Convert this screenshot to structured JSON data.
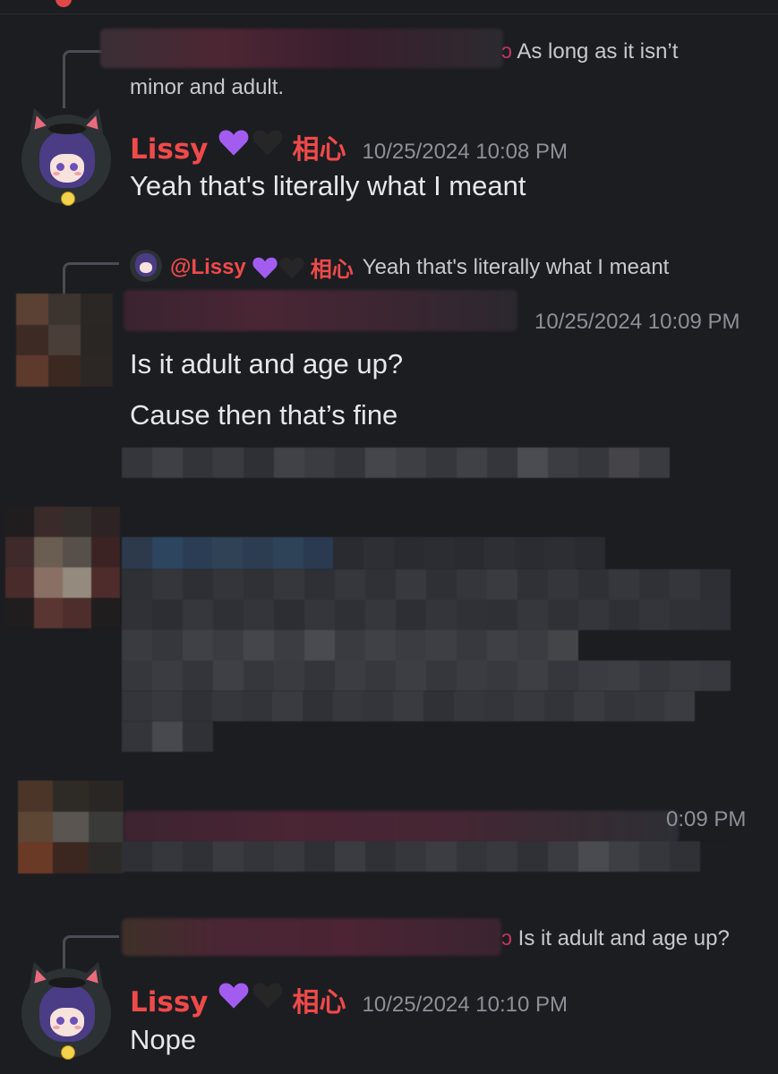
{
  "messages": [
    {
      "reply_text_line1": "As long as it isn’t",
      "reply_text_line2": "minor and adult.",
      "username": "Lissy",
      "emoji_1": "purple-heart-icon",
      "emoji_2": "black-heart-icon",
      "tag": "相心",
      "timestamp": "10/25/2024 10:08 PM",
      "text": "Yeah that's literally what I meant"
    },
    {
      "reply_mention": "@Lissy",
      "reply_tag": "相心",
      "reply_text": "Yeah that's literally what I meant",
      "timestamp": "10/25/2024 10:09 PM",
      "lines": [
        "Is it adult and age up?",
        "Cause then that’s fine"
      ]
    },
    {
      "timestamp_partial": "0:09 PM"
    },
    {
      "reply_text": "Is it adult and age up?",
      "username": "Lissy",
      "tag": "相心",
      "timestamp": "10/25/2024 10:10 PM",
      "text": "Nope"
    }
  ],
  "colors": {
    "background": "#1c1d21",
    "username": "#ef4a4a",
    "timestamp": "#8d9098",
    "purple_heart": "#a35cf0",
    "black_heart": "#2a2a2a"
  }
}
